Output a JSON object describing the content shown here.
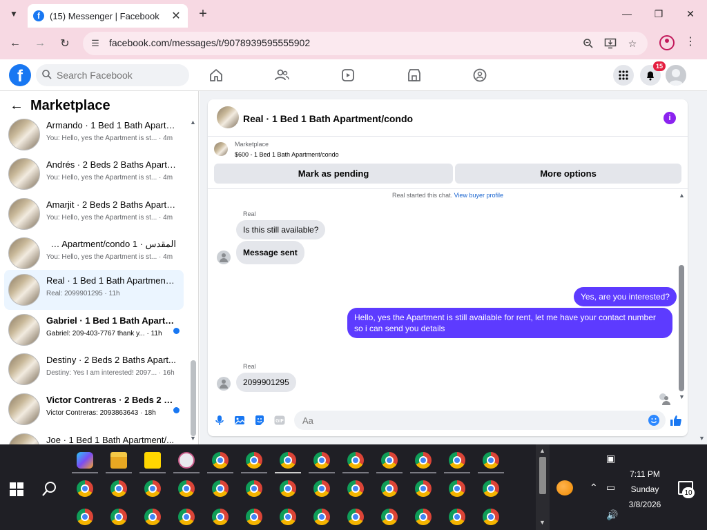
{
  "browser": {
    "tab_title": "(15) Messenger | Facebook",
    "url": "facebook.com/messages/t/9078939595555902"
  },
  "fb": {
    "logo": "f",
    "search_placeholder": "Search Facebook",
    "notification_count": "15",
    "brand_color": "#1877f2"
  },
  "sidebar": {
    "title": "Marketplace",
    "conversations": [
      {
        "name": "Armando · 1 Bed 1 Bath Apartm...",
        "snippet": "You: Hello, yes the Apartment is st... · 4m",
        "unread": false,
        "active": false
      },
      {
        "name": "Andrés · 2 Beds 2 Baths Apartm...",
        "snippet": "You: Hello, yes the Apartment is st... · 4m",
        "unread": false,
        "active": false
      },
      {
        "name": "Amarjit · 2 Beds 2 Baths Apartm...",
        "snippet": "You: Hello, yes the Apartment is st... · 4m",
        "unread": false,
        "active": false
      },
      {
        "name": "المقدس · 1 th Apartment/condo...",
        "snippet": "You: Hello, yes the Apartment is st... · 4m",
        "unread": false,
        "active": false
      },
      {
        "name": "Real · 1 Bed 1 Bath Apartment/c...",
        "snippet": "Real: 2099901295 · 11h",
        "unread": false,
        "active": true
      },
      {
        "name": "Gabriel · 1 Bed 1 Bath Apartm...",
        "snippet": "Gabriel: 209-403-7767 thank y... · 11h",
        "unread": true,
        "active": false
      },
      {
        "name": "Destiny · 2 Beds 2 Baths Apart...",
        "snippet": "Destiny: Yes I am interested! 2097... · 16h",
        "unread": false,
        "active": false
      },
      {
        "name": "Victor Contreras · 2 Beds 2 Ba...",
        "snippet": "Victor Contreras: 2093863643 · 18h",
        "unread": true,
        "active": false
      },
      {
        "name": "Joe · 1 Bed 1 Bath Apartment/...",
        "snippet": "",
        "unread": false,
        "active": false
      }
    ]
  },
  "chat": {
    "title": "Real · 1 Bed 1 Bath Apartment/condo",
    "marketplace_label": "Marketplace",
    "listing": "$600 - 1 Bed 1 Bath Apartment/condo",
    "mark_pending": "Mark as pending",
    "more_options": "More options",
    "system_text": "Real started this chat.",
    "system_link": "View buyer profile",
    "sender1": "Real",
    "msg_in_1": "Is this still available?",
    "msg_in_2": "Message sent",
    "msg_out_1": "Yes, are you interested?",
    "msg_out_2": "Hello, yes the Apartment is still available for rent, let me have your contact number so i can send you details",
    "sender2": "Real",
    "msg_in_3": "2099901295",
    "composer_placeholder": "Aa",
    "accent_color": "#5d3bff"
  },
  "taskbar": {
    "time": "7:11 PM",
    "day": "Sunday",
    "date": "3/8/2026",
    "notifications": "10"
  }
}
